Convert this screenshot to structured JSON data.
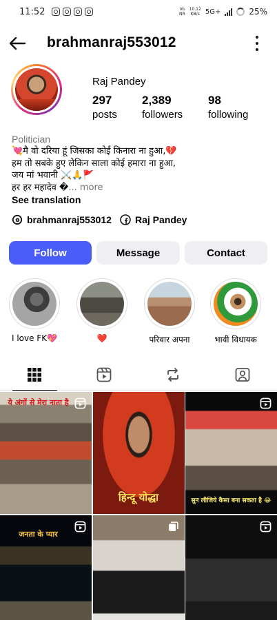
{
  "status_bar": {
    "time": "11:52",
    "network_top": "Vo",
    "network_bottom": "NR",
    "speed_top": "10.12",
    "speed_bottom": "KB/s",
    "signal": "5G+",
    "battery": "25%"
  },
  "header": {
    "username": "brahmanraj553012"
  },
  "profile": {
    "full_name": "Raj Pandey",
    "posts_count": "297",
    "posts_label": "posts",
    "followers_count": "2,389",
    "followers_label": "followers",
    "following_count": "98",
    "following_label": "following",
    "category": "Politician",
    "bio_lines": [
      "💘मै वो दरिया हूं जिसका कोई किनारा ना हुआ,💔",
      "हम तो सबके हुए लेकिन साला कोई हमारा ना हुआ,",
      "जय मां भवानी ⚔️🙏🚩",
      "हर हर महादेव �"
    ],
    "more_label": "... more",
    "see_translation": "See translation",
    "threads_handle": "brahmanraj553012",
    "facebook_name": "Raj Pandey"
  },
  "actions": {
    "follow": "Follow",
    "message": "Message",
    "contact": "Contact"
  },
  "highlights": [
    {
      "label": "I love FK💖"
    },
    {
      "label": "❤️"
    },
    {
      "label": "परिवार अपना"
    },
    {
      "label": "भावी विधायक"
    }
  ],
  "tabs": [
    "grid-icon",
    "reels-icon",
    "reposts-icon",
    "tagged-icon"
  ],
  "posts": [
    {
      "caption": "ये अंगों से मेरा नाता है",
      "caption_position": "top",
      "is_reel": true
    },
    {
      "caption": "हिन्दू योद्धा",
      "caption_position": "bottom",
      "is_reel": false
    },
    {
      "caption": "सुन लीजिये कैसा बना सकता है 😂",
      "caption_position": "bottom",
      "is_reel": true
    },
    {
      "caption": "जनता के प्यार",
      "caption_position": "top",
      "is_reel": true
    },
    {
      "caption": "",
      "caption_position": "none",
      "is_reel": false,
      "is_album": true
    },
    {
      "caption": "",
      "caption_position": "none",
      "is_reel": true
    }
  ],
  "colors": {
    "follow_button": "#4a5df9",
    "secondary_button": "#efeff3",
    "muted_text": "#737373"
  }
}
